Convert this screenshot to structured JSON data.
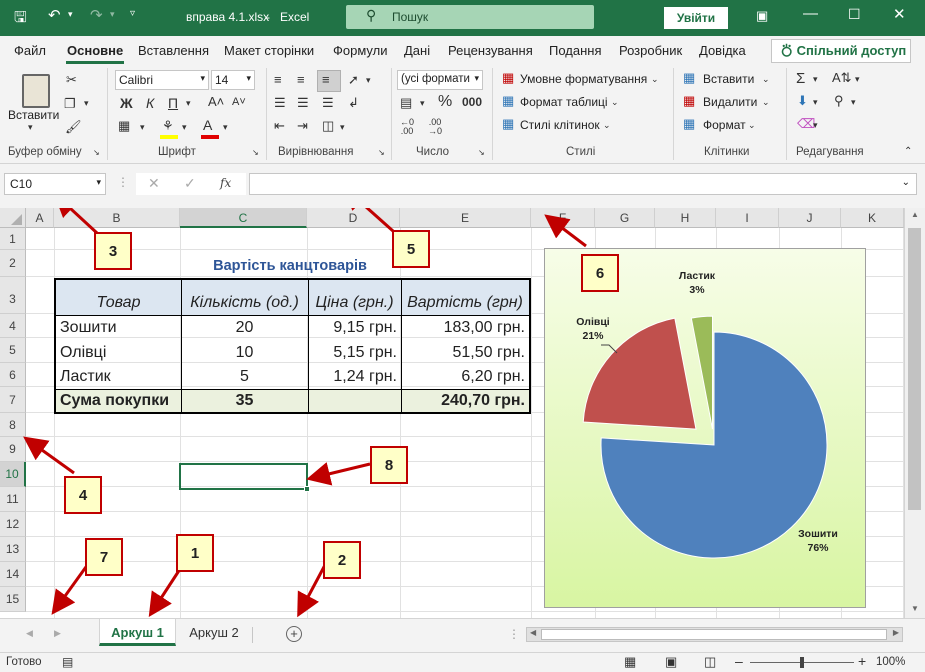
{
  "titlebar": {
    "filename": "вправа 4.1.xlsx",
    "sep": "-",
    "app": "Excel",
    "search_placeholder": "Пошук",
    "signin": "Увійти"
  },
  "ribbon_tabs": [
    "Файл",
    "Основне",
    "Вставлення",
    "Макет сторінки",
    "Формули",
    "Дані",
    "Рецензування",
    "Подання",
    "Розробник",
    "Довідка"
  ],
  "share_label": "Спільний доступ",
  "ribbon": {
    "paste": "Вставити",
    "font_name": "Calibri",
    "font_size": "14",
    "bold": "Ж",
    "italic": "К",
    "underline": "П",
    "number_format": "(усі формати",
    "conditional": "Умовне форматування",
    "format_table": "Формат таблиці",
    "cell_styles": "Стилі клітинок",
    "insert": "Вставити",
    "delete": "Видалити",
    "format": "Формат",
    "groups": {
      "clipboard": "Буфер обміну",
      "font": "Шрифт",
      "alignment": "Вирівнювання",
      "number": "Число",
      "styles": "Стилі",
      "cells": "Клітинки",
      "editing": "Редагування"
    }
  },
  "formula_bar": {
    "namebox": "C10",
    "fx": "fx",
    "formula": ""
  },
  "columns": [
    "A",
    "B",
    "C",
    "D",
    "E",
    "F",
    "G",
    "H",
    "I",
    "J",
    "K"
  ],
  "rows": [
    "1",
    "2",
    "3",
    "4",
    "5",
    "6",
    "7",
    "8",
    "9",
    "10",
    "11",
    "12",
    "13",
    "14",
    "15"
  ],
  "table": {
    "title": "Вартість канцтоварів",
    "headers": [
      "Товар",
      "Кількість (од.)",
      "Ціна (грн.)",
      "Вартість (грн)"
    ],
    "rows": [
      [
        "Зошити",
        "20",
        "9,15 грн.",
        "183,00 грн."
      ],
      [
        "Олівці",
        "10",
        "5,15 грн.",
        "51,50 грн."
      ],
      [
        "Ластик",
        "5",
        "1,24 грн.",
        "6,20 грн."
      ]
    ],
    "total": [
      "Сума покупки",
      "35",
      "",
      "240,70 грн."
    ]
  },
  "chart_data": {
    "type": "pie",
    "title": "",
    "categories": [
      "Зошити",
      "Олівці",
      "Ластик"
    ],
    "values": [
      76,
      21,
      3
    ],
    "unit": "%",
    "colors": [
      "#4f81bd",
      "#c0504d",
      "#9bbb59"
    ],
    "data_labels": [
      "Зошити 76%",
      "Олівці 21%",
      "Ластик 3%"
    ],
    "exploded": true,
    "legend": "none"
  },
  "chart_labels": [
    {
      "name": "Зошити",
      "pct": "76%"
    },
    {
      "name": "Олівці",
      "pct": "21%"
    },
    {
      "name": "Ластик",
      "pct": "3%"
    }
  ],
  "callouts": [
    "1",
    "2",
    "3",
    "4",
    "5",
    "6",
    "7",
    "8"
  ],
  "sheets": [
    "Аркуш 1",
    "Аркуш 2"
  ],
  "status": {
    "ready": "Готово",
    "zoom": "100%"
  },
  "colors": {
    "excel_green": "#217346",
    "callout_border": "#c00000",
    "callout_fill": "#ffffc8",
    "table_title": "#2e5597",
    "header_fill": "#dce6f1",
    "total_fill": "#ebf1de"
  }
}
